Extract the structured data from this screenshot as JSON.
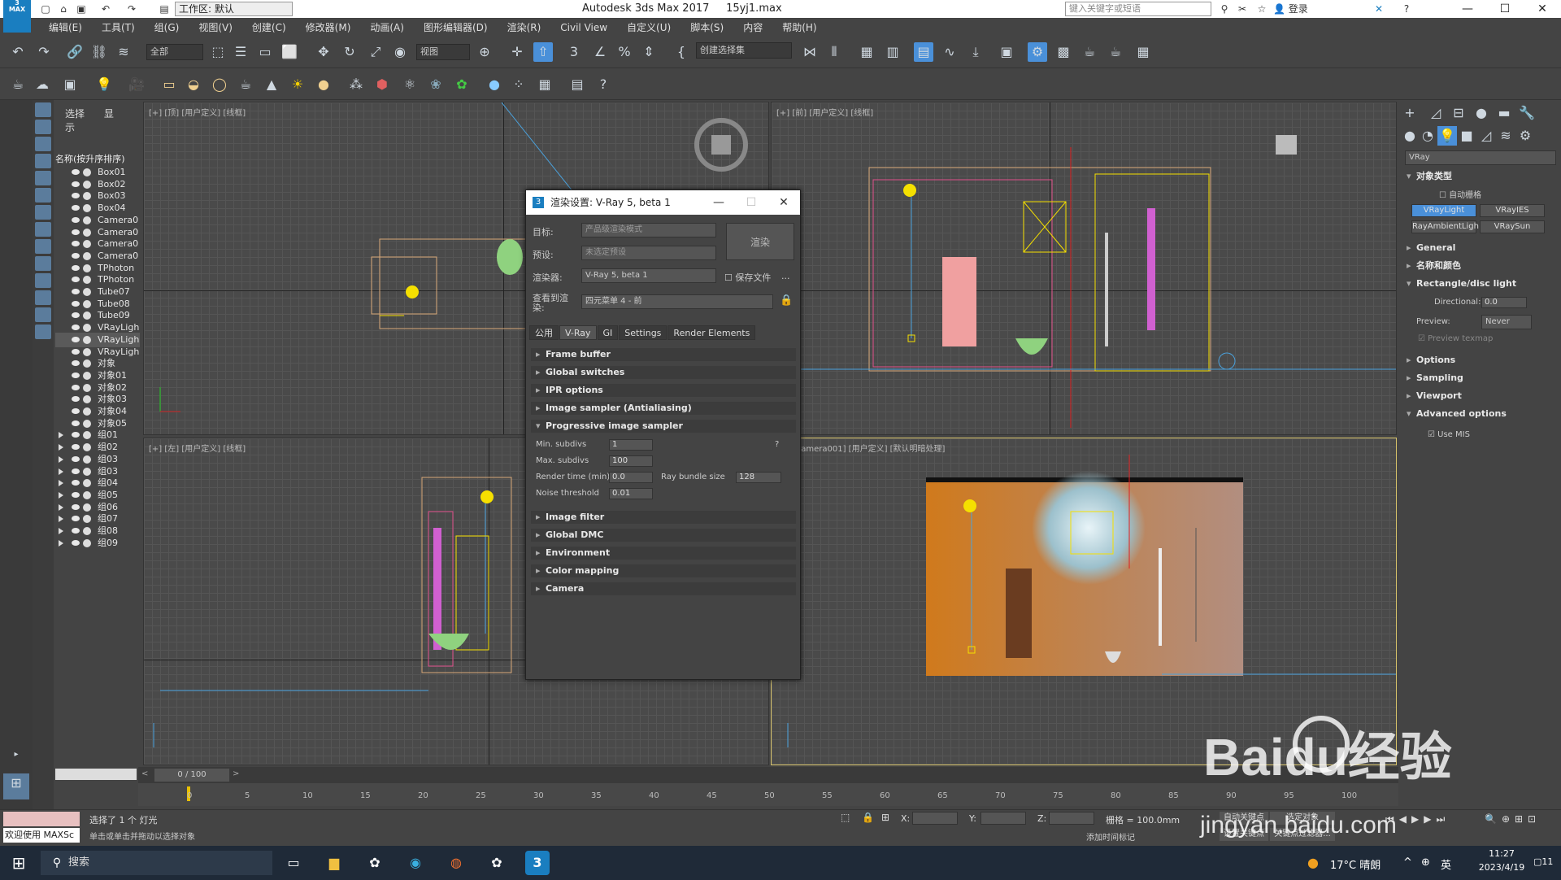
{
  "app": {
    "title": "Autodesk 3ds Max 2017",
    "file": "15yj1.max",
    "logo_text": "3",
    "logo_sub": "MAX",
    "workspace": "工作区: 默认",
    "search_placeholder": "键入关键字或短语",
    "login": "登录",
    "window_controls": [
      "—",
      "☐",
      "✕"
    ]
  },
  "menu": [
    "编辑(E)",
    "工具(T)",
    "组(G)",
    "视图(V)",
    "创建(C)",
    "修改器(M)",
    "动画(A)",
    "图形编辑器(D)",
    "渲染(R)",
    "Civil View",
    "自定义(U)",
    "脚本(S)",
    "内容",
    "帮助(H)"
  ],
  "toolbar": {
    "filter": "全部",
    "refcoord": "视图",
    "selset": "创建选择集"
  },
  "scene_explorer": {
    "tabs": [
      "选择",
      "显示"
    ],
    "header": "名称(按升序排序)",
    "items": [
      {
        "name": "Box01",
        "sel": false,
        "group": false
      },
      {
        "name": "Box02",
        "sel": false,
        "group": false
      },
      {
        "name": "Box03",
        "sel": false,
        "group": false
      },
      {
        "name": "Box04",
        "sel": false,
        "group": false
      },
      {
        "name": "Camera0",
        "sel": false,
        "group": false
      },
      {
        "name": "Camera0",
        "sel": false,
        "group": false
      },
      {
        "name": "Camera0",
        "sel": false,
        "group": false
      },
      {
        "name": "Camera0",
        "sel": false,
        "group": false
      },
      {
        "name": "TPhoton",
        "sel": false,
        "group": false
      },
      {
        "name": "TPhoton",
        "sel": false,
        "group": false
      },
      {
        "name": "Tube07",
        "sel": false,
        "group": false
      },
      {
        "name": "Tube08",
        "sel": false,
        "group": false
      },
      {
        "name": "Tube09",
        "sel": false,
        "group": false
      },
      {
        "name": "VRayLigh",
        "sel": false,
        "group": false
      },
      {
        "name": "VRayLigh",
        "sel": true,
        "group": false
      },
      {
        "name": "VRayLigh",
        "sel": false,
        "group": false
      },
      {
        "name": "对象",
        "sel": false,
        "group": false
      },
      {
        "name": "对象01",
        "sel": false,
        "group": false
      },
      {
        "name": "对象02",
        "sel": false,
        "group": false
      },
      {
        "name": "对象03",
        "sel": false,
        "group": false
      },
      {
        "name": "对象04",
        "sel": false,
        "group": false
      },
      {
        "name": "对象05",
        "sel": false,
        "group": false
      },
      {
        "name": "组01",
        "sel": false,
        "group": true
      },
      {
        "name": "组02",
        "sel": false,
        "group": true
      },
      {
        "name": "组03",
        "sel": false,
        "group": true
      },
      {
        "name": "组03",
        "sel": false,
        "group": true
      },
      {
        "name": "组04",
        "sel": false,
        "group": true
      },
      {
        "name": "组05",
        "sel": false,
        "group": true
      },
      {
        "name": "组06",
        "sel": false,
        "group": true
      },
      {
        "name": "组07",
        "sel": false,
        "group": true
      },
      {
        "name": "组08",
        "sel": false,
        "group": true
      },
      {
        "name": "组09",
        "sel": false,
        "group": true
      }
    ]
  },
  "viewports": {
    "top": "[+] [顶] [用户定义] [线框]",
    "front": "[+] [前] [用户定义] [线框]",
    "left": "[+] [左] [用户定义] [线框]",
    "camera": "[+] [Camera001] [用户定义] [默认明暗处理]"
  },
  "render_dialog": {
    "title": "渲染设置: V-Ray 5, beta 1",
    "target_label": "目标:",
    "target_value": "产品级渲染模式",
    "preset_label": "预设:",
    "preset_value": "未选定预设",
    "renderer_label": "渲染器:",
    "renderer_value": "V-Ray 5, beta 1",
    "save_file": "保存文件",
    "more": "...",
    "view_label": "查看到渲染:",
    "view_value": "四元菜单 4 - 前",
    "render_button": "渲染",
    "tabs": [
      "公用",
      "V-Ray",
      "GI",
      "Settings",
      "Render Elements"
    ],
    "rollouts_top": [
      "Frame buffer",
      "Global switches",
      "IPR options",
      "Image sampler (Antialiasing)",
      "Progressive image sampler"
    ],
    "rollouts_bottom": [
      "Image filter",
      "Global DMC",
      "Environment",
      "Color mapping",
      "Camera"
    ],
    "params": {
      "min_subdivs_label": "Min. subdivs",
      "min_subdivs": "1",
      "max_subdivs_label": "Max. subdivs",
      "max_subdivs": "100",
      "render_time_label": "Render time (min)",
      "render_time": "0.0",
      "ray_bundle_label": "Ray bundle size",
      "ray_bundle": "128",
      "noise_label": "Noise threshold",
      "noise": "0.01",
      "help": "?"
    }
  },
  "command_panel": {
    "category": "VRay",
    "object_type": "对象类型",
    "autogrid": "自动栅格",
    "buttons": [
      "VRayLight",
      "VRayIES",
      "RayAmbientLigh",
      "VRaySun"
    ],
    "rollouts": [
      "General",
      "名称和颜色",
      "Rectangle/disc light"
    ],
    "directional_label": "Directional:",
    "directional_value": "0.0",
    "preview_label": "Preview:",
    "preview_value": "Never",
    "preview_texmap": "Preview texmap",
    "rollouts2": [
      "Options",
      "Sampling",
      "Viewport",
      "Advanced options"
    ],
    "use_mis": "Use MIS"
  },
  "timeline": {
    "frame": "0 / 100",
    "ticks": [
      "0",
      "5",
      "10",
      "15",
      "20",
      "25",
      "30",
      "35",
      "40",
      "45",
      "50",
      "55",
      "60",
      "65",
      "70",
      "75",
      "80",
      "85",
      "90",
      "95",
      "100"
    ]
  },
  "status": {
    "welcome": "欢迎使用 MAXSc",
    "selected": "选择了 1 个 灯光",
    "hint": "单击或单击并拖动以选择对象",
    "x_label": "X:",
    "y_label": "Y:",
    "z_label": "Z:",
    "grid": "栅格 = 100.0mm",
    "add_key": "添加时间标记",
    "auto_key": "自动关键点",
    "sel_obj": "选定对象",
    "set_key": "设置关键点",
    "key_filter": "关键点过滤器..."
  },
  "taskbar": {
    "search": "搜索",
    "weather": "17°C 晴朗",
    "lang": "英",
    "time": "11:27",
    "date": "2023/4/19",
    "notif": "11"
  },
  "watermark": {
    "brand": "Baidu经验",
    "url": "jingyan.baidu.com"
  },
  "colors": {
    "accent": "#1a7ec0",
    "selected_button": "#4a90d9"
  }
}
